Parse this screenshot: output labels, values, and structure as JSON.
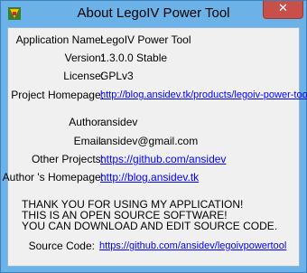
{
  "window": {
    "title": "About LegoIV Power Tool",
    "close_glyph": "✕",
    "icon": "app-icon"
  },
  "info": {
    "app_name_label": "Application Name:",
    "app_name_value": "LegoIV Power Tool",
    "version_label": "Version:",
    "version_value": "1.3.0.0 Stable",
    "license_label": "License:",
    "license_value": "GPLv3",
    "homepage_label": "Project Homepage:",
    "homepage_value": "http://blog.ansidev.tk/products/legoiv-power-tool/",
    "author_label": "Author:",
    "author_value": "ansidev",
    "email_label": "Email:",
    "email_value": "ansidev@gmail.com",
    "other_label": "Other Projects:",
    "other_value": "https://github.com/ansidev",
    "author_home_label": "Author 's Homepage:",
    "author_home_value": "http://blog.ansidev.tk"
  },
  "message": {
    "line1": "THANK YOU FOR USING MY APPLICATION!",
    "line2": "THIS IS AN OPEN SOURCE SOFTWARE!",
    "line3": "YOU CAN DOWNLOAD AND EDIT SOURCE CODE."
  },
  "source": {
    "label": "Source Code:",
    "value": "https://github.com/ansidev/legoivpowertool"
  },
  "colors": {
    "frame": "#6bb2e8",
    "close": "#c7504a",
    "link": "#0000ff"
  }
}
